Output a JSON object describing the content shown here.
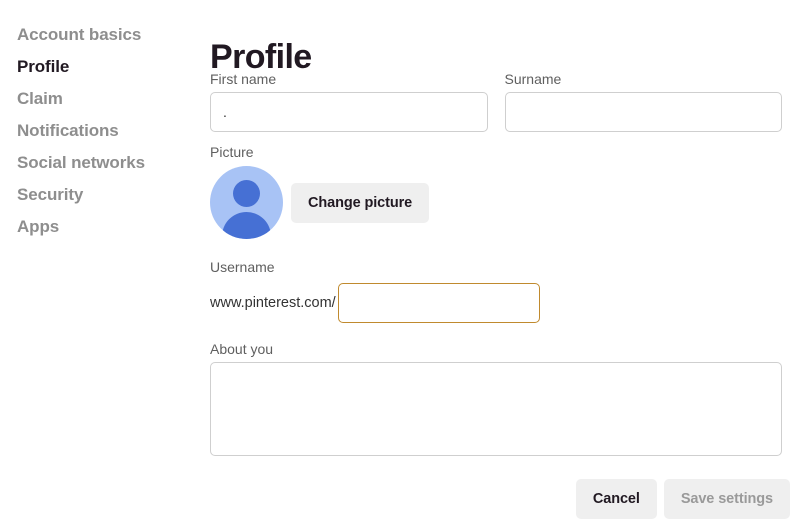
{
  "sidebar": {
    "items": [
      {
        "label": "Account basics",
        "active": false
      },
      {
        "label": "Profile",
        "active": true
      },
      {
        "label": "Claim",
        "active": false
      },
      {
        "label": "Notifications",
        "active": false
      },
      {
        "label": "Social networks",
        "active": false
      },
      {
        "label": "Security",
        "active": false
      },
      {
        "label": "Apps",
        "active": false
      }
    ]
  },
  "main": {
    "title": "Profile",
    "first_name": {
      "label": "First name",
      "value": ".",
      "placeholder": ""
    },
    "surname": {
      "label": "Surname",
      "value": "",
      "placeholder": ""
    },
    "picture": {
      "label": "Picture",
      "avatar_icon": "default-user-avatar-icon",
      "change_button_label": "Change picture"
    },
    "username": {
      "label": "Username",
      "prefix": "www.pinterest.com/",
      "value": "",
      "placeholder": ""
    },
    "about": {
      "label": "About you",
      "value": "",
      "placeholder": ""
    }
  },
  "footer": {
    "cancel_label": "Cancel",
    "save_label": "Save settings"
  },
  "colors": {
    "accent_focus_border": "#c08a2e",
    "active_nav_text": "#211922",
    "inactive_nav_text": "#8e8e8e",
    "button_background": "#efefef",
    "disabled_button_text": "#9a9a9a",
    "avatar_background": "#a8c3f5",
    "avatar_figure": "#4670d4",
    "input_border": "#cfcfcf"
  }
}
